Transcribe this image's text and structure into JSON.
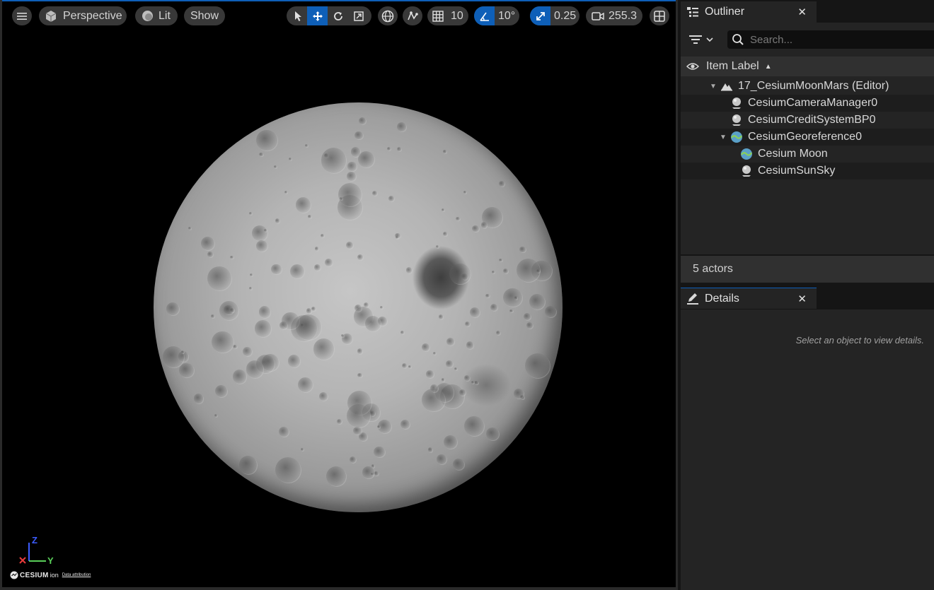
{
  "viewport": {
    "view_mode": "Perspective",
    "lighting": "Lit",
    "show_label": "Show",
    "grid_snap": "10",
    "rotation_snap": "10°",
    "scale_snap": "0.25",
    "camera_speed": "255.3",
    "gizmo": {
      "z": "Z",
      "y": "Y"
    },
    "logo": {
      "brand": "CESIUM",
      "ion": "ion",
      "attribution": "Data attribution"
    }
  },
  "outliner": {
    "tab_title": "Outliner",
    "search_placeholder": "Search...",
    "column_label": "Item Label",
    "rows": [
      {
        "label": "17_CesiumMoonMars (Editor)",
        "icon": "level-icon"
      },
      {
        "label": "CesiumCameraManager0",
        "icon": "actor-icon"
      },
      {
        "label": "CesiumCreditSystemBP0",
        "icon": "actor-icon"
      },
      {
        "label": "CesiumGeoreference0",
        "icon": "globe-icon"
      },
      {
        "label": "Cesium Moon",
        "icon": "globe-icon"
      },
      {
        "label": "CesiumSunSky",
        "icon": "actor-icon"
      }
    ],
    "actor_count": "5 actors"
  },
  "details": {
    "tab_title": "Details",
    "hint": "Select an object to view details."
  },
  "colors": {
    "accent": "#0e5fb8",
    "panel": "#242424",
    "background": "#151515"
  }
}
